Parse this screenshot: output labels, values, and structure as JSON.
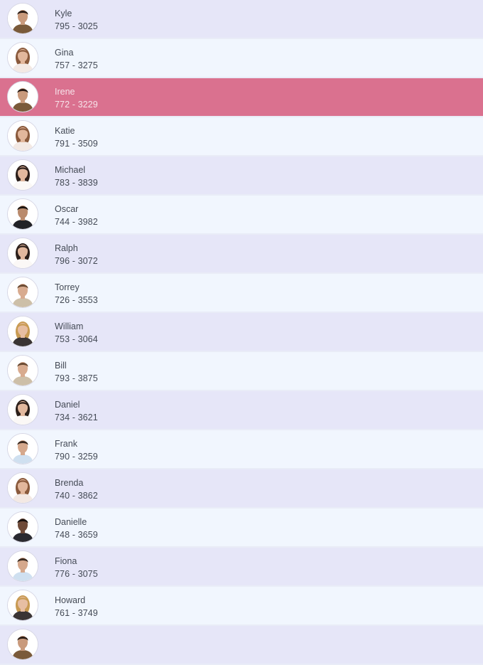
{
  "contacts": [
    {
      "name": "Kyle",
      "phone": "795 - 3025",
      "selected": false,
      "avatar": "man-brown-jacket-avatar"
    },
    {
      "name": "Gina",
      "phone": "757 - 3275",
      "selected": false,
      "avatar": "woman-long-hair-avatar"
    },
    {
      "name": "Irene",
      "phone": "772 - 3229",
      "selected": true,
      "avatar": "man-brown-jacket-avatar"
    },
    {
      "name": "Katie",
      "phone": "791 - 3509",
      "selected": false,
      "avatar": "woman-long-hair-avatar"
    },
    {
      "name": "Michael",
      "phone": "783 - 3839",
      "selected": false,
      "avatar": "woman-dark-hair-avatar"
    },
    {
      "name": "Oscar",
      "phone": "744 - 3982",
      "selected": false,
      "avatar": "man-black-shirt-avatar"
    },
    {
      "name": "Ralph",
      "phone": "796 - 3072",
      "selected": false,
      "avatar": "woman-dark-hair-avatar"
    },
    {
      "name": "Torrey",
      "phone": "726 - 3553",
      "selected": false,
      "avatar": "man-tan-suit-avatar"
    },
    {
      "name": "William",
      "phone": "753 - 3064",
      "selected": false,
      "avatar": "woman-blonde-avatar"
    },
    {
      "name": "Bill",
      "phone": "793 - 3875",
      "selected": false,
      "avatar": "man-tan-suit-avatar"
    },
    {
      "name": "Daniel",
      "phone": "734 - 3621",
      "selected": false,
      "avatar": "woman-dark-hair-avatar"
    },
    {
      "name": "Frank",
      "phone": "790 - 3259",
      "selected": false,
      "avatar": "man-blue-shirt-avatar"
    },
    {
      "name": "Brenda",
      "phone": "740 - 3862",
      "selected": false,
      "avatar": "woman-long-hair-avatar"
    },
    {
      "name": "Danielle",
      "phone": "748 - 3659",
      "selected": false,
      "avatar": "man-dark-suit-avatar"
    },
    {
      "name": "Fiona",
      "phone": "776 - 3075",
      "selected": false,
      "avatar": "man-blue-shirt-avatar"
    },
    {
      "name": "Howard",
      "phone": "761 - 3749",
      "selected": false,
      "avatar": "woman-blonde-avatar"
    },
    {
      "name": "",
      "phone": "",
      "selected": false,
      "avatar": "man-brown-jacket-avatar"
    }
  ],
  "colors": {
    "row_odd": "#e6e6f8",
    "row_even": "#f1f6fe",
    "selected": "#da718f",
    "text": "#444a55"
  }
}
